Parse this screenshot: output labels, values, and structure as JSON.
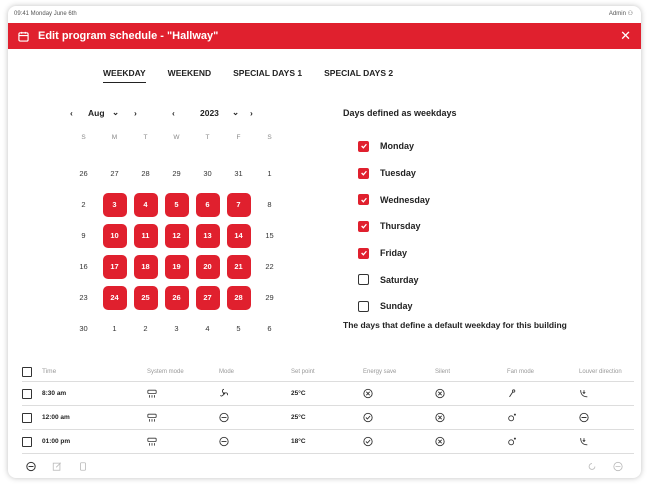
{
  "status": {
    "time": "09:41 Monday June 6th",
    "user": "Admin"
  },
  "dialog": {
    "title": "Edit program schedule - \"Hallway\"",
    "close": "✕"
  },
  "tabs": [
    {
      "label": "WEEKDAY",
      "active": true
    },
    {
      "label": "WEEKEND",
      "active": false
    },
    {
      "label": "SPECIAL DAYS 1",
      "active": false
    },
    {
      "label": "SPECIAL DAYS 2",
      "active": false
    }
  ],
  "calendar": {
    "prev_month": "‹",
    "month": "Aug",
    "month_caret": "⌄",
    "next_month": "›",
    "prev_year": "‹",
    "year": "2023",
    "year_caret": "⌄",
    "next_year": "›",
    "weekdays": [
      "S",
      "M",
      "T",
      "W",
      "T",
      "F",
      "S"
    ],
    "weeks": [
      [
        {
          "d": "26"
        },
        {
          "d": "27"
        },
        {
          "d": "28"
        },
        {
          "d": "29"
        },
        {
          "d": "30"
        },
        {
          "d": "31"
        },
        {
          "d": "1"
        }
      ],
      [
        {
          "d": "2"
        },
        {
          "d": "3",
          "sel": true
        },
        {
          "d": "4",
          "sel": true
        },
        {
          "d": "5",
          "sel": true
        },
        {
          "d": "6",
          "sel": true
        },
        {
          "d": "7",
          "sel": true
        },
        {
          "d": "8"
        }
      ],
      [
        {
          "d": "9"
        },
        {
          "d": "10",
          "sel": true
        },
        {
          "d": "11",
          "sel": true
        },
        {
          "d": "12",
          "sel": true
        },
        {
          "d": "13",
          "sel": true
        },
        {
          "d": "14",
          "sel": true
        },
        {
          "d": "15"
        }
      ],
      [
        {
          "d": "16"
        },
        {
          "d": "17",
          "sel": true
        },
        {
          "d": "18",
          "sel": true
        },
        {
          "d": "19",
          "sel": true
        },
        {
          "d": "20",
          "sel": true
        },
        {
          "d": "21",
          "sel": true
        },
        {
          "d": "22"
        }
      ],
      [
        {
          "d": "23"
        },
        {
          "d": "24",
          "sel": true
        },
        {
          "d": "25",
          "sel": true
        },
        {
          "d": "26",
          "sel": true
        },
        {
          "d": "27",
          "sel": true
        },
        {
          "d": "28",
          "sel": true
        },
        {
          "d": "29"
        }
      ],
      [
        {
          "d": "30"
        },
        {
          "d": "1"
        },
        {
          "d": "2"
        },
        {
          "d": "3"
        },
        {
          "d": "4"
        },
        {
          "d": "5"
        },
        {
          "d": "6"
        }
      ]
    ]
  },
  "weekdays_panel": {
    "title": "Days defined as weekdays",
    "days": [
      {
        "label": "Monday",
        "checked": true
      },
      {
        "label": "Tuesday",
        "checked": true
      },
      {
        "label": "Wednesday",
        "checked": true
      },
      {
        "label": "Thursday",
        "checked": true
      },
      {
        "label": "Friday",
        "checked": true
      },
      {
        "label": "Saturday",
        "checked": false
      },
      {
        "label": "Sunday",
        "checked": false
      }
    ],
    "note": "The days that define a default weekday for this building"
  },
  "table": {
    "headers": [
      "Time",
      "System mode",
      "Mode",
      "Set point",
      "Energy save",
      "Silent",
      "Fan mode",
      "Louver direction"
    ],
    "rows": [
      {
        "time": "8:30 am",
        "system": "ac-unit-icon",
        "mode": "fan-icon",
        "setpoint": "25°C",
        "energy": "circle-x-icon",
        "silent": "circle-x-icon",
        "fan": "fan-speed-icon",
        "louver": "louver-icon"
      },
      {
        "time": "12:00 am",
        "system": "ac-unit-icon",
        "mode": "circle-minus-icon",
        "setpoint": "25°C",
        "energy": "circle-check-icon",
        "silent": "circle-x-icon",
        "fan": "fan-auto-icon",
        "louver": "circle-minus-icon"
      },
      {
        "time": "01:00 pm",
        "system": "ac-unit-icon",
        "mode": "circle-minus-icon",
        "setpoint": "18°C",
        "energy": "circle-check-icon",
        "silent": "circle-x-icon",
        "fan": "fan-auto-icon",
        "louver": "louver-icon"
      }
    ]
  },
  "accent": "#e0202e"
}
